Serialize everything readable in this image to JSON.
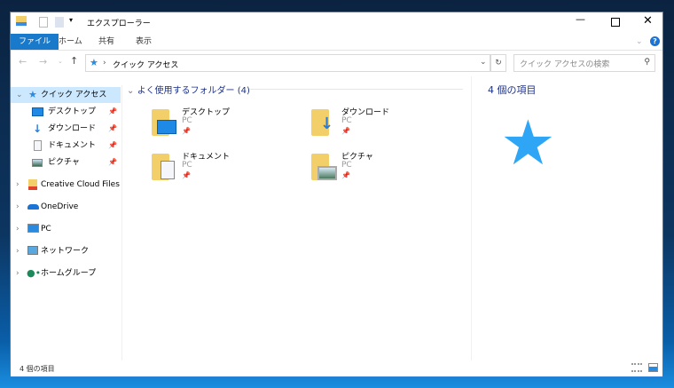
{
  "window": {
    "title": "エクスプローラー",
    "minimize_icon": "minimize-icon",
    "maximize_icon": "maximize-icon",
    "close_icon": "close-icon"
  },
  "ribbon": {
    "tabs": [
      "ファイル",
      "ホーム",
      "共有",
      "表示"
    ]
  },
  "address": {
    "path": [
      "クイック アクセス"
    ],
    "search_placeholder": "クイック アクセスの検索"
  },
  "nav": {
    "quick_access": "クイック アクセス",
    "pinned": [
      "デスクトップ",
      "ダウンロード",
      "ドキュメント",
      "ピクチャ"
    ],
    "groups": [
      "Creative Cloud Files",
      "OneDrive",
      "PC",
      "ネットワーク",
      "ホームグループ"
    ]
  },
  "content": {
    "section_title": "よく使用するフォルダー (4)",
    "folders": [
      {
        "name": "デスクトップ",
        "location": "PC"
      },
      {
        "name": "ダウンロード",
        "location": "PC"
      },
      {
        "name": "ドキュメント",
        "location": "PC"
      },
      {
        "name": "ピクチャ",
        "location": "PC"
      }
    ]
  },
  "details": {
    "count": "4 個の項目"
  },
  "status": {
    "count": "4 個の項目"
  },
  "colors": {
    "accent": "#1979ca",
    "selection": "#cce8ff",
    "section": "#1e3287"
  }
}
